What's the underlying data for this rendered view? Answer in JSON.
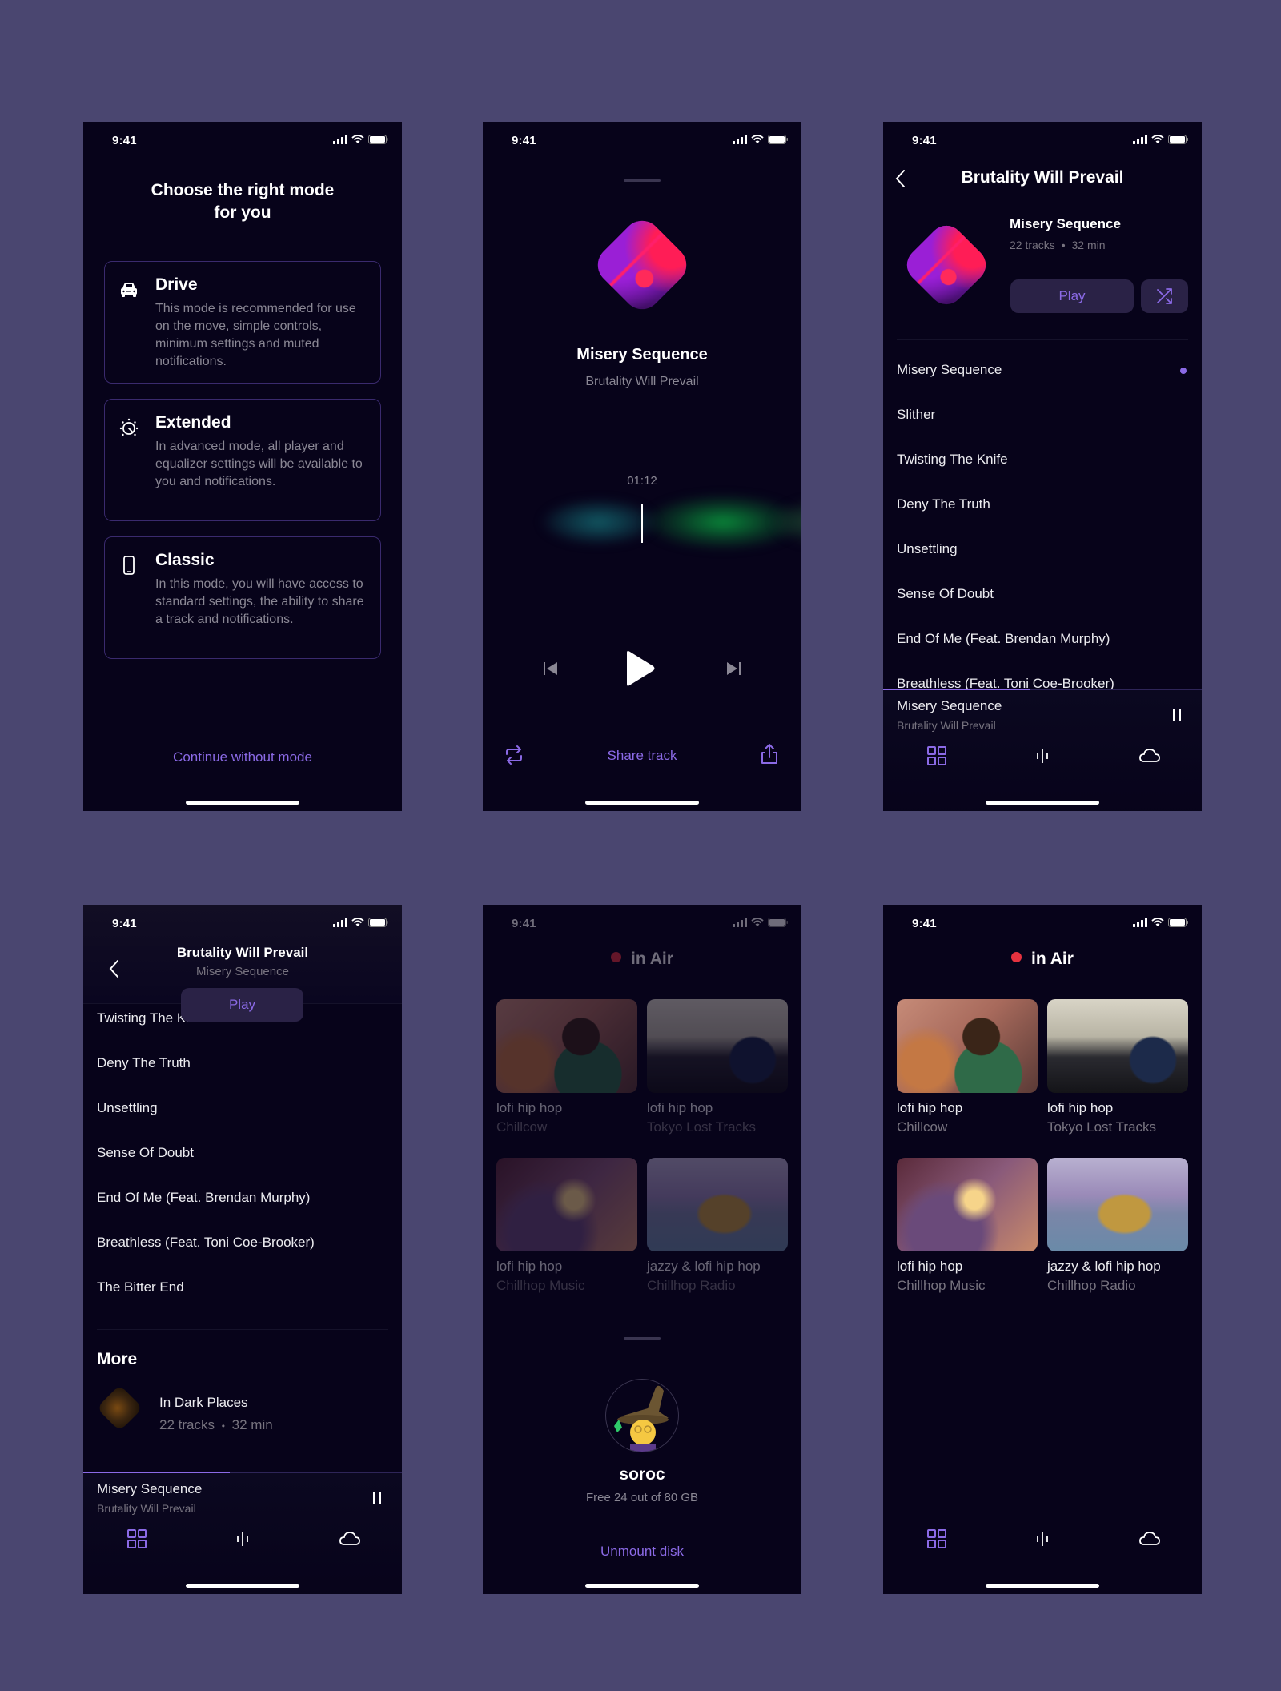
{
  "colors": {
    "background": "#4a4670",
    "phone_bg": "#07031a",
    "accent": "#8b6ae6",
    "live_red": "#e5323f",
    "muted_text": "#8a8794"
  },
  "status_bar": {
    "time": "9:41",
    "icons": [
      "signal-icon",
      "wifi-icon",
      "battery-icon"
    ]
  },
  "screen_mode": {
    "title_line1": "Choose the right mode",
    "title_line2": "for you",
    "modes": [
      {
        "icon": "car-icon",
        "name": "Drive",
        "description": "This mode is recommended for use on the move, simple controls, minimum settings and muted notifications."
      },
      {
        "icon": "clock-timer-icon",
        "name": "Extended",
        "description": "In advanced mode, all player and equalizer settings will be available to you and notifications."
      },
      {
        "icon": "phone-icon",
        "name": "Classic",
        "description": "In this mode, you will have access to standard settings, the ability to share a track and notifications."
      }
    ],
    "continue_label": "Continue without mode"
  },
  "screen_player": {
    "track_title": "Misery Sequence",
    "artist": "Brutality Will Prevail",
    "elapsed": "01:12",
    "share_label": "Share track",
    "controls": [
      "skip-back-icon",
      "play-icon",
      "skip-forward-icon"
    ],
    "bottom_icons": [
      "repeat-icon",
      "share-icon"
    ]
  },
  "screen_album": {
    "header_title": "Brutality Will Prevail",
    "album_title": "Misery Sequence",
    "track_count": "22 tracks",
    "duration": "32 min",
    "play_label": "Play",
    "tracks": [
      {
        "title": "Misery Sequence",
        "playing": true
      },
      {
        "title": "Slither",
        "playing": false
      },
      {
        "title": "Twisting The Knife",
        "playing": false
      },
      {
        "title": "Deny The Truth",
        "playing": false
      },
      {
        "title": "Unsettling",
        "playing": false
      },
      {
        "title": "Sense Of Doubt",
        "playing": false
      },
      {
        "title": "End Of Me (Feat. Brendan Murphy)",
        "playing": false
      },
      {
        "title": "Breathless (Feat. Toni Coe-Brooker)",
        "playing": false
      }
    ]
  },
  "screen_album_scrolled": {
    "header_title": "Brutality Will Prevail",
    "header_subtitle": "Misery Sequence",
    "play_label": "Play",
    "tracks": [
      "Twisting The Knife",
      "Deny The Truth",
      "Unsettling",
      "Sense Of Doubt",
      "End Of Me (Feat. Brendan Murphy)",
      "Breathless (Feat. Toni Coe-Brooker)",
      "The Bitter End"
    ],
    "more_heading": "More",
    "more_items": [
      {
        "title": "In Dark Places",
        "track_count": "22 tracks",
        "duration": "32 min"
      }
    ]
  },
  "mini_player": {
    "title": "Misery Sequence",
    "artist": "Brutality Will Prevail",
    "progress": 0.46
  },
  "tab_bar": {
    "tabs": [
      {
        "icon": "grid-icon",
        "active": true
      },
      {
        "icon": "waveform-icon",
        "active": false
      },
      {
        "icon": "cloud-icon",
        "active": false
      }
    ]
  },
  "screen_in_air": {
    "heading": "in Air",
    "stations": [
      {
        "title": "lofi hip hop",
        "channel": "Chillcow"
      },
      {
        "title": "lofi hip hop",
        "channel": "Tokyo Lost Tracks"
      },
      {
        "title": "lofi hip hop",
        "channel": "Chillhop Music"
      },
      {
        "title": "jazzy & lofi hip hop",
        "channel": "Chillhop Radio"
      }
    ]
  },
  "disk_sheet": {
    "name": "soroc",
    "storage": "Free 24 out of 80 GB",
    "unmount_label": "Unmount disk"
  }
}
